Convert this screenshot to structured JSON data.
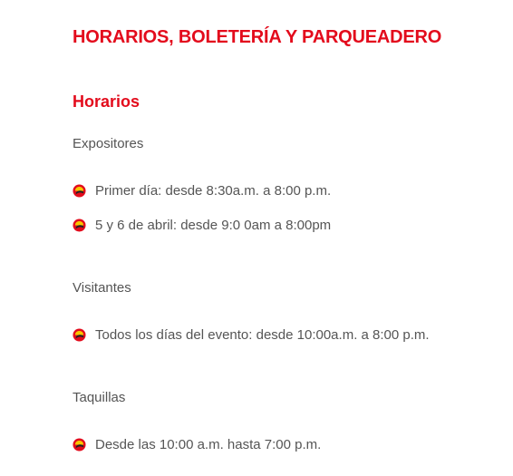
{
  "page": {
    "title": "HORARIOS, BOLETERÍA Y PARQUEADERO",
    "section_title": "Horarios"
  },
  "groups": [
    {
      "label": "Expositores",
      "items": [
        "Primer día: desde 8:30a.m. a 8:00 p.m.",
        "5 y 6 de abril: desde 9:0 0am a 8:00pm"
      ]
    },
    {
      "label": "Visitantes",
      "items": [
        "Todos los días del evento: desde 10:00a.m. a 8:00 p.m."
      ]
    },
    {
      "label": "Taquillas",
      "items": [
        "Desde las 10:00 a.m. hasta 7:00 p.m."
      ]
    }
  ],
  "colors": {
    "accent": "#e30b1c",
    "text": "#555555",
    "bullet_red": "#e30b1c",
    "bullet_yellow": "#f7c600",
    "bullet_dark": "#222222"
  },
  "icons": {
    "bullet": "brand-bullet-icon"
  }
}
